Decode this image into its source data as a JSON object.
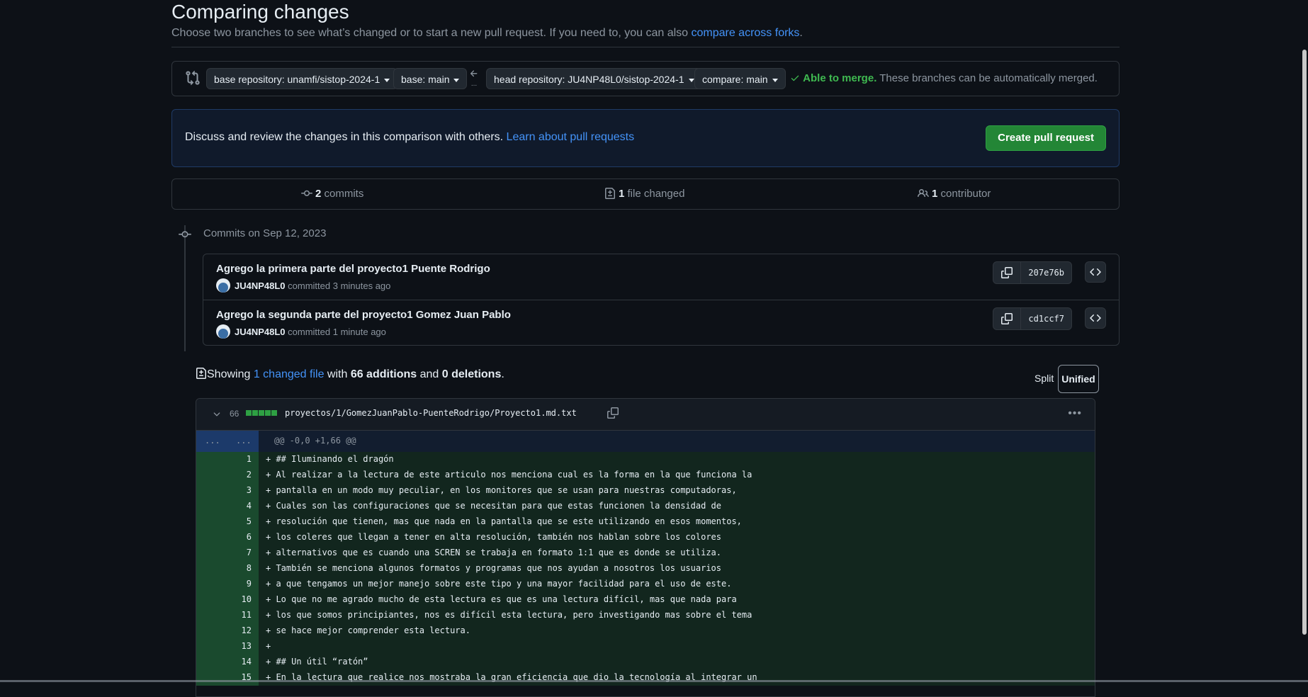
{
  "header": {
    "title": "Comparing changes",
    "subtitle_prefix": "Choose two branches to see what’s changed or to start a new pull request. If you need to, you can also ",
    "subtitle_link": "compare across forks",
    "subtitle_suffix": "."
  },
  "range": {
    "base_repo_label": "base repository: unamfi/sistop-2024-1",
    "base_label": "base: main",
    "head_repo_label": "head repository: JU4NP48L0/sistop-2024-1",
    "compare_label": "compare: main",
    "merge_status": "Able to merge.",
    "merge_desc": " These branches can be automatically merged."
  },
  "flash": {
    "text": "Discuss and review the changes in this comparison with others. ",
    "link": "Learn about pull requests",
    "button": "Create pull request"
  },
  "summary": {
    "commits_count": "2",
    "commits_label": " commits",
    "files_count": "1",
    "files_label": " file changed",
    "contributors_count": "1",
    "contributors_label": " contributor"
  },
  "commits": {
    "heading": "Commits on Sep 12, 2023",
    "items": [
      {
        "title": "Agrego la primera parte del proyecto1 Puente Rodrigo",
        "author": "JU4NP48L0",
        "time": " committed 3 minutes ago",
        "sha": "207e76b"
      },
      {
        "title": "Agrego la segunda parte del proyecto1 Gomez Juan Pablo",
        "author": "JU4NP48L0",
        "time": " committed 1 minute ago",
        "sha": "cd1ccf7"
      }
    ]
  },
  "diff_toolbar": {
    "showing": "Showing ",
    "changed_file_link": "1 changed file",
    "with": " with ",
    "additions": "66 additions",
    "and": " and ",
    "deletions": "0 deletions",
    "end": ".",
    "split": "Split",
    "unified": "Unified"
  },
  "file": {
    "count": "66",
    "path": "proyectos/1/GomezJuanPablo-PuenteRodrigo/Proyecto1.md.txt",
    "hunk_left": "...",
    "hunk_right": "...",
    "hunk_header": "@@ -0,0 +1,66 @@",
    "lines": [
      {
        "n": "1",
        "text": "+ ## Iluminando el dragón"
      },
      {
        "n": "2",
        "text": "+ Al realizar a la lectura de este articulo nos menciona cual es la forma en la que funciona la"
      },
      {
        "n": "3",
        "text": "+ pantalla en un modo muy peculiar, en los monitores que se usan para nuestras computadoras,"
      },
      {
        "n": "4",
        "text": "+ Cuales son las configuraciones que se necesitan para que estas funcionen la densidad de"
      },
      {
        "n": "5",
        "text": "+ resolución que tienen, mas que nada en la pantalla que se este utilizando en esos momentos,"
      },
      {
        "n": "6",
        "text": "+ los coleres que llegan a tener en alta resolución, también nos hablan sobre los colores"
      },
      {
        "n": "7",
        "text": "+ alternativos que es cuando una SCREN se trabaja en formato 1:1 que es donde se utiliza."
      },
      {
        "n": "8",
        "text": "+ También se menciona algunos formatos y programas que nos ayudan a nosotros los usuarios"
      },
      {
        "n": "9",
        "text": "+ a que tengamos un mejor manejo sobre este tipo y una mayor facilidad para el uso de este."
      },
      {
        "n": "10",
        "text": "+ Lo que no me agrado mucho de esta lectura es que es una lectura difícil, mas que nada para"
      },
      {
        "n": "11",
        "text": "+ los que somos principiantes, nos es difícil esta lectura, pero investigando mas sobre el tema"
      },
      {
        "n": "12",
        "text": "+ se hace mejor comprender esta lectura."
      },
      {
        "n": "13",
        "text": "+"
      },
      {
        "n": "14",
        "text": "+ ## Un útil “ratón”"
      },
      {
        "n": "15",
        "text": "+ En la lectura que realice nos mostraba la gran eficiencia que dio la tecnología al integrar un"
      }
    ]
  }
}
